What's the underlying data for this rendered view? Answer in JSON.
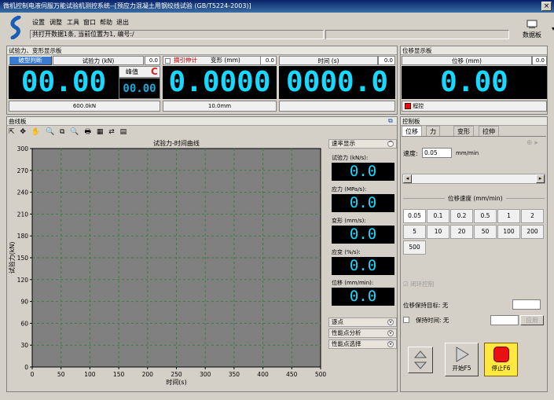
{
  "app": {
    "title": "微机控制电液伺服万能试验机测控系统--[预应力混凝土用钢绞线试验 (GB/T5224-2003)]",
    "close": "×"
  },
  "menu": [
    "设置",
    "调整",
    "工具",
    "窗口",
    "帮助",
    "退出"
  ],
  "status": {
    "message": "共打开数据1条, 当前位置为1, 编号:/"
  },
  "toolbar": {
    "databoard": "数据板",
    "dropdown": "▾"
  },
  "test_panel": {
    "title": "试验力、变形显示板",
    "force": {
      "break_btn": "破型判断",
      "label": "试验力 (kN)",
      "zero": "0.0",
      "value": "00.00",
      "peak_label": "峰值",
      "peak_value": "00.00",
      "footer": "600.0kN",
      "refresh": "C"
    },
    "deform": {
      "checkbox_label": "摘引伸计",
      "label": "变形 (mm)",
      "zero": "0.0",
      "value": "0.0000",
      "footer": "10.0mm"
    },
    "time": {
      "label": "时间 (s)",
      "zero": "0.0",
      "value": "0000.0"
    }
  },
  "pos_panel": {
    "title": "位移显示板",
    "label": "位移 (mm)",
    "zero": "0.0",
    "value": "0.00",
    "mode": "程控"
  },
  "curve": {
    "title": "曲线板",
    "chart_title": "试验力-时间曲线",
    "tools": [
      "⇱",
      "✥",
      "✋",
      "🔍",
      "⧉",
      "🔍",
      "🖶",
      "▦",
      "⇄",
      "▤"
    ],
    "restore": "⧉"
  },
  "rate": {
    "title": "速率显示",
    "items": [
      {
        "label": "试验力 (kN/s):",
        "value": "0.0"
      },
      {
        "label": "应力 (MPa/s):",
        "value": "0.0"
      },
      {
        "label": "变形 (mm/s):",
        "value": "0.0"
      },
      {
        "label": "应变 (%/s):",
        "value": "0.0"
      },
      {
        "label": "位移 (mm/min):",
        "value": "0.0"
      }
    ],
    "sections": [
      "逐点",
      "性能点分析",
      "性能点选择"
    ]
  },
  "control": {
    "title": "控制板",
    "tabs": [
      "位移",
      "力",
      "变形",
      "拉伸"
    ],
    "speed_label": "速度:",
    "speed_value": "0.05",
    "speed_unit": "mm/min",
    "pos_speed_label": "位移速度 (mm/min)",
    "speeds": [
      "0.05",
      "0.1",
      "0.2",
      "0.5",
      "1",
      "2",
      "5",
      "10",
      "20",
      "50",
      "100",
      "200",
      "500"
    ],
    "closed_loop": "闭环控制",
    "hold_target": "位移保持目标: 无",
    "hold_time": "保持时间: 无",
    "apply": "应用",
    "start": "开始F5",
    "stop": "停止F6",
    "scroll_left": "◂",
    "scroll_right": "▸"
  },
  "chart_data": {
    "type": "line",
    "title": "试验力-时间曲线",
    "xlabel": "时间(s)",
    "ylabel": "试验力(kN)",
    "xlim": [
      0,
      500
    ],
    "ylim": [
      0,
      300
    ],
    "xticks": [
      0,
      50,
      100,
      150,
      200,
      250,
      300,
      350,
      400,
      450,
      500
    ],
    "yticks": [
      0,
      30,
      60,
      90,
      120,
      150,
      180,
      210,
      240,
      270,
      300
    ],
    "series": [],
    "grid": true,
    "colors": {
      "plot_bg": "#808080",
      "grid": "#3c7e3c"
    }
  }
}
